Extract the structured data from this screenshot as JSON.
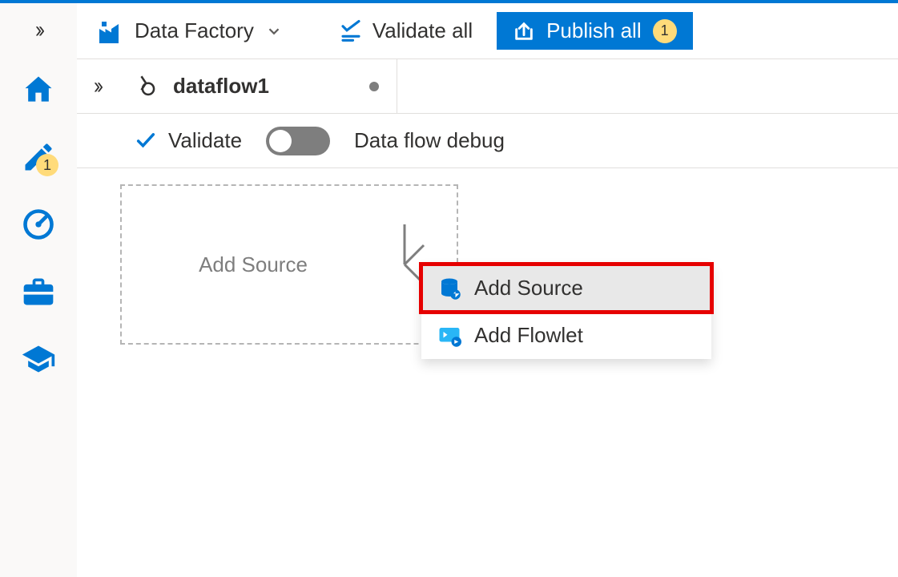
{
  "breadcrumb": {
    "title": "Data Factory"
  },
  "toolbar": {
    "validate_all_label": "Validate all",
    "publish_label": "Publish all",
    "publish_count": "1"
  },
  "rail": {
    "author_badge": "1"
  },
  "tab": {
    "name": "dataflow1"
  },
  "subbar": {
    "validate_label": "Validate",
    "debug_label": "Data flow debug"
  },
  "canvas": {
    "add_source": "Add Source"
  },
  "menu": {
    "add_source": "Add Source",
    "add_flowlet": "Add Flowlet"
  }
}
